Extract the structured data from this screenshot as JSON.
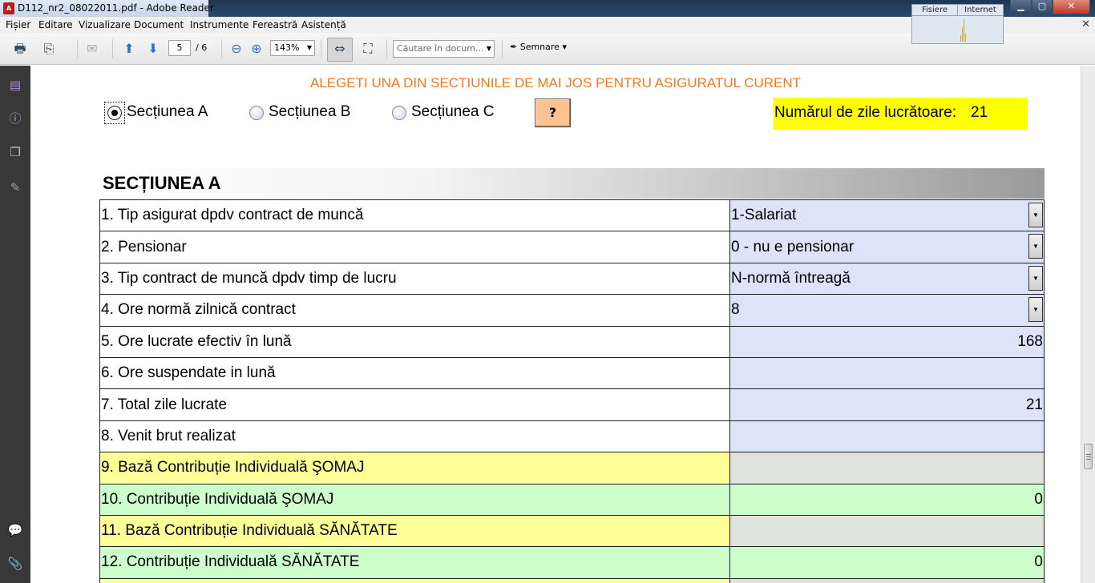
{
  "window": {
    "title": "D112_nr2_08022011.pdf - Adobe Reader"
  },
  "netmon": {
    "tab1": "Fisiere",
    "tab2": "Internet"
  },
  "menu": [
    "Fișier",
    "Editare",
    "Vizualizare",
    "Document",
    "Instrumente",
    "Fereastră",
    "Asistență"
  ],
  "toolbar": {
    "page_current": "5",
    "page_total": "/ 6",
    "zoom": "143%",
    "search_placeholder": "Căutare în docum...",
    "sign_label": "Semnare"
  },
  "doc": {
    "instruction": "ALEGETI UNA DIN SECTIUNILE DE MAI JOS PENTRU ASIGURATUL CURENT",
    "radios": [
      {
        "label": "Secțiunea A",
        "selected": true
      },
      {
        "label": "Secțiunea B",
        "selected": false
      },
      {
        "label": "Secțiunea C",
        "selected": false
      }
    ],
    "help_label": "?",
    "zile_label": "Numărul de zile lucrătoare:",
    "zile_value": "21",
    "section_title": "SECȚIUNEA A",
    "rows": [
      {
        "label": "1. Tip asigurat dpdv contract de muncă",
        "value": "1-Salariat",
        "kind": "dropdown"
      },
      {
        "label": "2. Pensionar",
        "value": "0 - nu e pensionar",
        "kind": "dropdown"
      },
      {
        "label": "3. Tip contract de muncă dpdv timp de lucru",
        "value": "N-normă întreagă",
        "kind": "dropdown"
      },
      {
        "label": "4. Ore normă zilnică contract",
        "value": "8",
        "kind": "dropdown"
      },
      {
        "label": "5. Ore lucrate efectiv în lună",
        "value": "168",
        "kind": "number"
      },
      {
        "label": "6. Ore suspendate in lună",
        "value": "",
        "kind": "number"
      },
      {
        "label": "7. Total zile lucrate",
        "value": "21",
        "kind": "number"
      },
      {
        "label": "8. Venit brut realizat",
        "value": "",
        "kind": "number"
      },
      {
        "label": "9. Bază Contribuție Individuală ŞOMAJ",
        "value": "",
        "kind": "grey"
      },
      {
        "label": "10. Contribuție Individuală ŞOMAJ",
        "value": "0",
        "kind": "green"
      },
      {
        "label": "11. Bază Contribuție Individuală SĂNĂTATE",
        "value": "",
        "kind": "grey"
      },
      {
        "label": "12. Contribuție Individuală SĂNĂTATE",
        "value": "0",
        "kind": "green"
      }
    ]
  }
}
